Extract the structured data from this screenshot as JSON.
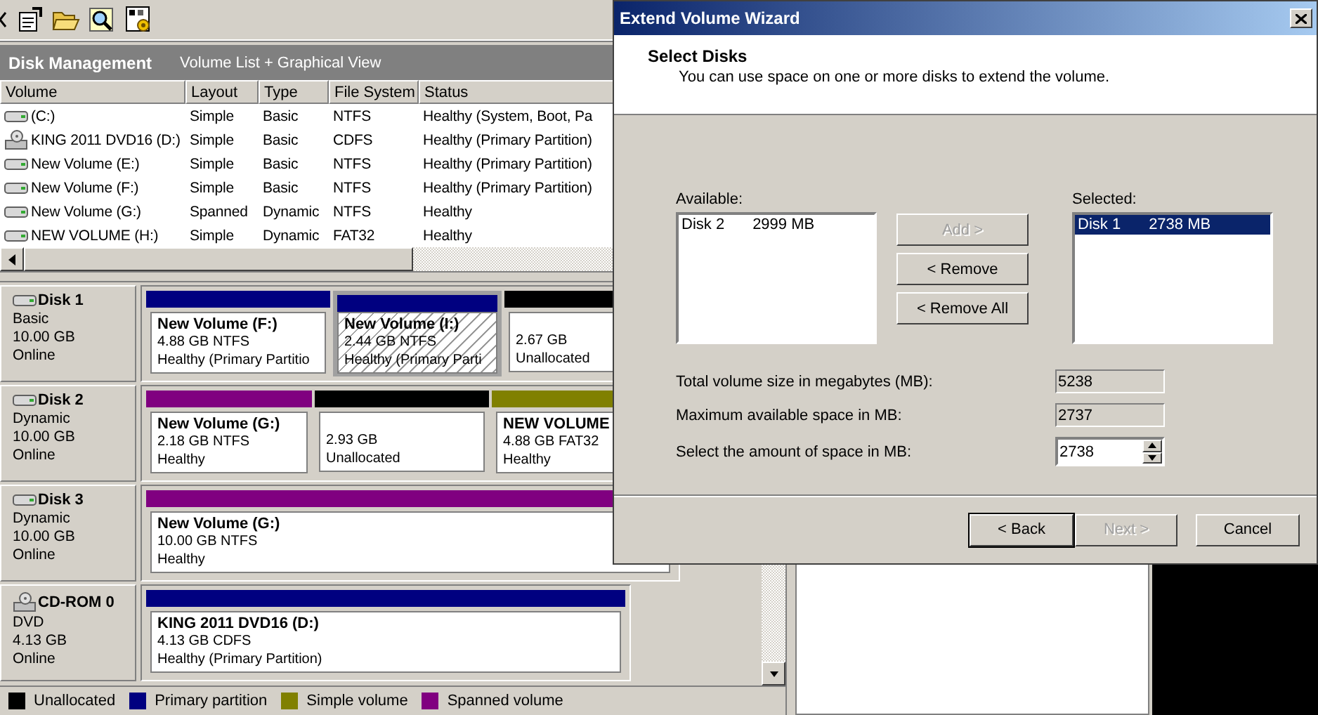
{
  "header": {
    "title": "Disk Management",
    "view": "Volume List + Graphical View"
  },
  "volume_list": {
    "columns": [
      "Volume",
      "Layout",
      "Type",
      "File System",
      "Status"
    ],
    "rows": [
      {
        "kind": "disk",
        "cells": [
          "(C:)",
          "Simple",
          "Basic",
          "NTFS",
          "Healthy (System, Boot, Pa"
        ]
      },
      {
        "kind": "cdrom",
        "cells": [
          "KING 2011 DVD16 (D:)",
          "Simple",
          "Basic",
          "CDFS",
          "Healthy (Primary Partition)"
        ]
      },
      {
        "kind": "disk",
        "cells": [
          "New Volume (E:)",
          "Simple",
          "Basic",
          "NTFS",
          "Healthy (Primary Partition)"
        ]
      },
      {
        "kind": "disk",
        "cells": [
          "New Volume (F:)",
          "Simple",
          "Basic",
          "NTFS",
          "Healthy (Primary Partition)"
        ]
      },
      {
        "kind": "disk",
        "cells": [
          "New Volume (G:)",
          "Spanned",
          "Dynamic",
          "NTFS",
          "Healthy"
        ]
      },
      {
        "kind": "disk",
        "cells": [
          "NEW VOLUME (H:)",
          "Simple",
          "Dynamic",
          "FAT32",
          "Healthy"
        ]
      }
    ]
  },
  "disks": [
    {
      "kind": "disk",
      "name": "Disk 1",
      "type": "Basic",
      "size": "10.00 GB",
      "status": "Online",
      "partitions": [
        {
          "name": "New Volume  (F:)",
          "detail": "4.88 GB NTFS",
          "status": "Healthy (Primary Partitio",
          "color": "#000080",
          "selected": false
        },
        {
          "name": "New Volume  (I:)",
          "detail": "2.44 GB NTFS",
          "status": "Healthy (Primary Parti",
          "color": "#000080",
          "selected": true
        },
        {
          "detail": "2.67 GB",
          "status": "Unallocated",
          "color": "#000000",
          "selected": false
        }
      ]
    },
    {
      "kind": "disk",
      "name": "Disk 2",
      "type": "Dynamic",
      "size": "10.00 GB",
      "status": "Online",
      "partitions": [
        {
          "name": "New Volume  (G:)",
          "detail": "2.18 GB NTFS",
          "status": "Healthy",
          "color": "#800080",
          "selected": false
        },
        {
          "detail": "2.93 GB",
          "status": "Unallocated",
          "color": "#000000",
          "selected": false
        },
        {
          "name": "NEW VOLUME",
          "detail": "4.88 GB FAT32",
          "status": "Healthy",
          "color": "#808000",
          "selected": false
        }
      ]
    },
    {
      "kind": "disk",
      "name": "Disk 3",
      "type": "Dynamic",
      "size": "10.00 GB",
      "status": "Online",
      "partitions": [
        {
          "name": "New Volume  (G:)",
          "detail": "10.00 GB NTFS",
          "status": "Healthy",
          "color": "#800080",
          "selected": false
        }
      ]
    },
    {
      "kind": "cdrom",
      "name": "CD-ROM 0",
      "type": "DVD",
      "size": "4.13 GB",
      "status": "Online",
      "partitions": [
        {
          "name": "KING 2011 DVD16  (D:)",
          "detail": "4.13 GB CDFS",
          "status": "Healthy (Primary Partition)",
          "color": "#000080",
          "selected": false
        }
      ]
    }
  ],
  "legend": [
    {
      "label": "Unallocated",
      "color": "#000000"
    },
    {
      "label": "Primary partition",
      "color": "#000080"
    },
    {
      "label": "Simple volume",
      "color": "#808000"
    },
    {
      "label": "Spanned volume",
      "color": "#800080"
    }
  ],
  "dialog": {
    "title": "Extend Volume Wizard",
    "heading": "Select Disks",
    "subheading": "You can use space on one or more disks to extend the volume.",
    "available_label": "Available:",
    "available": [
      {
        "disk": "Disk 2",
        "space": "2999 MB",
        "selected": false
      }
    ],
    "buttons": [
      {
        "label": "Add >",
        "disabled": true
      },
      {
        "label": "< Remove",
        "disabled": false
      },
      {
        "label": "< Remove All",
        "disabled": false
      }
    ],
    "selected_label": "Selected:",
    "selected": [
      {
        "disk": "Disk 1",
        "space": "2738 MB",
        "selected": true
      }
    ],
    "fields": [
      {
        "label": "Total volume size in megabytes (MB):",
        "value": "5238",
        "kind": "readonly"
      },
      {
        "label": "Maximum available space in MB:",
        "value": "2737",
        "kind": "readonly"
      },
      {
        "label": "Select the amount of space in MB:",
        "value": "2738",
        "kind": "spinner"
      }
    ],
    "footer_buttons": [
      {
        "label": "< Back",
        "disabled": false,
        "default": true
      },
      {
        "label": "Next >",
        "disabled": true,
        "default": false
      },
      {
        "label": "Cancel",
        "disabled": false,
        "default": false
      }
    ]
  }
}
